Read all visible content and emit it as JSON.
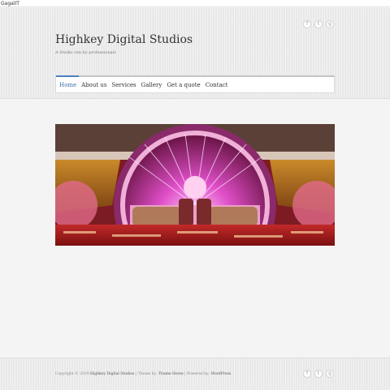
{
  "topbar": {
    "text": "GagalIT"
  },
  "header": {
    "site_title": "Highkey Digital Studios",
    "tagline": "A Studio run by professionals",
    "social_icons": [
      "facebook-icon",
      "twitter-icon",
      "google-plus-icon"
    ]
  },
  "nav": {
    "items": [
      {
        "label": "Home",
        "active": true
      },
      {
        "label": "About us"
      },
      {
        "label": "Services"
      },
      {
        "label": "Gallery"
      },
      {
        "label": "Get a quote"
      },
      {
        "label": "Contact"
      }
    ]
  },
  "hero": {
    "description": "stage-decoration-photo"
  },
  "footer": {
    "copyright": "Copyright © 2019 ",
    "site_link": "Highkey Digital Studios",
    "theme_prefix": " | Theme by: ",
    "theme_link": "Theme Horse",
    "powered_prefix": " | Powered by: ",
    "powered_link": "WordPress",
    "social_icons": [
      "facebook-icon",
      "twitter-icon",
      "google-plus-icon"
    ]
  },
  "colors": {
    "accent": "#4a7fc1",
    "background": "#f4f4f4",
    "header_bg": "#ececec"
  }
}
